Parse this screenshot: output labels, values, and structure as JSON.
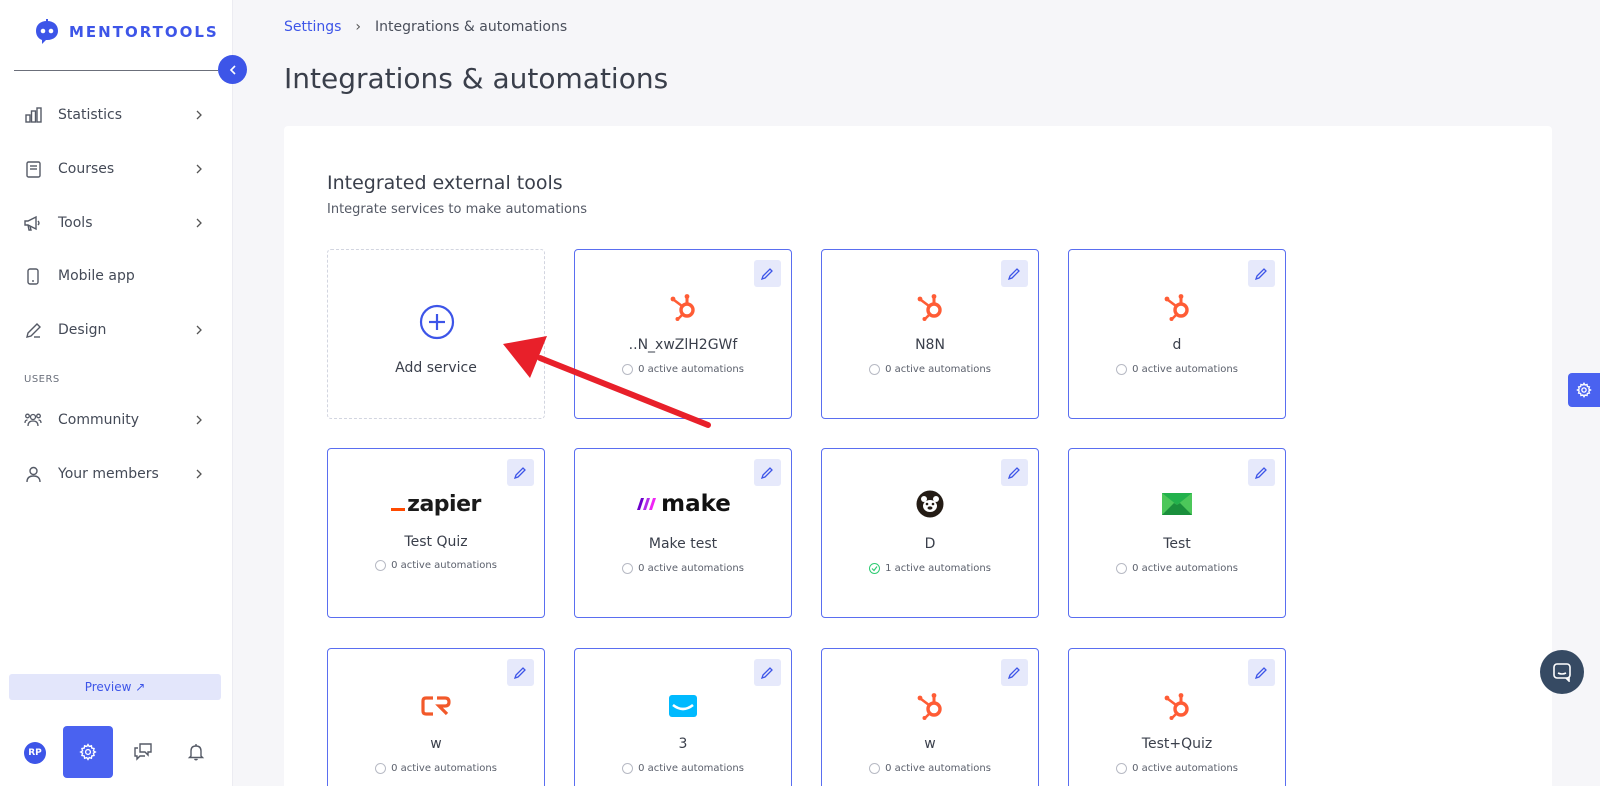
{
  "app": {
    "logo_text": "MENTORTOOLS"
  },
  "sidebar": {
    "items": [
      {
        "label": "Statistics",
        "icon": "bar-chart-icon",
        "has_chevron": true
      },
      {
        "label": "Courses",
        "icon": "book-icon",
        "has_chevron": true
      },
      {
        "label": "Tools",
        "icon": "megaphone-icon",
        "has_chevron": true
      },
      {
        "label": "Mobile app",
        "icon": "phone-icon",
        "has_chevron": false
      },
      {
        "label": "Design",
        "icon": "pencil-icon",
        "has_chevron": true
      }
    ],
    "users_section_label": "USERS",
    "user_items": [
      {
        "label": "Community",
        "icon": "people-icon",
        "has_chevron": true
      },
      {
        "label": "Your members",
        "icon": "person-icon",
        "has_chevron": true
      }
    ],
    "preview_label": "Preview ↗",
    "avatar_initials": "RP"
  },
  "breadcrumb": {
    "parent": "Settings",
    "current": "Integrations & automations"
  },
  "page_title": "Integrations & automations",
  "panel": {
    "title": "Integrated external tools",
    "subtitle": "Integrate services to make automations",
    "add_label": "Add service",
    "cards": [
      {
        "name": "..N_xwZlH2GWf",
        "service": "hubspot",
        "status": "0 active automations",
        "active": false
      },
      {
        "name": "N8N",
        "service": "hubspot",
        "status": "0 active automations",
        "active": false
      },
      {
        "name": "d",
        "service": "hubspot",
        "status": "0 active automations",
        "active": false
      },
      {
        "name": "Test Quiz",
        "service": "zapier",
        "status": "0 active automations",
        "active": false
      },
      {
        "name": "Make test",
        "service": "make",
        "status": "0 active automations",
        "active": false
      },
      {
        "name": "D",
        "service": "mailchimp",
        "status": "1 active automations",
        "active": true
      },
      {
        "name": "Test",
        "service": "mailerlite",
        "status": "0 active automations",
        "active": false
      },
      {
        "name": "w",
        "service": "cr",
        "status": "0 active automations",
        "active": false
      },
      {
        "name": "3",
        "service": "getresponse",
        "status": "0 active automations",
        "active": false
      },
      {
        "name": "w",
        "service": "hubspot",
        "status": "0 active automations",
        "active": false
      },
      {
        "name": "Test+Quiz",
        "service": "hubspot",
        "status": "0 active automations",
        "active": false
      }
    ],
    "logo_text": {
      "zapier": "zapier",
      "make": "make"
    }
  },
  "colors": {
    "accent": "#3d55e8",
    "hubspot": "#ff5c35",
    "active": "#2ecb73",
    "annotation_arrow": "#e8202a"
  }
}
